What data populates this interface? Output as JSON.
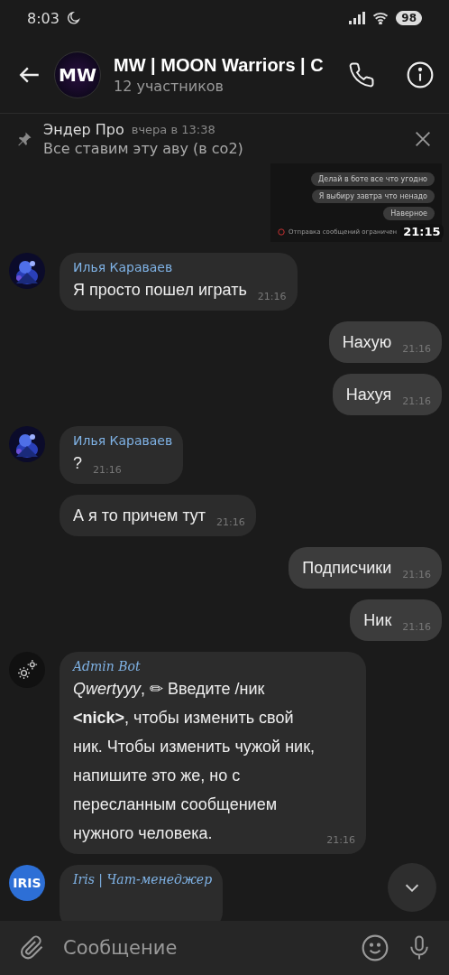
{
  "status_bar": {
    "time": "8:03",
    "battery": "98"
  },
  "header": {
    "avatar_text": "MW",
    "title": "MW | MOON Warriors | С",
    "subtitle": "12 участников"
  },
  "pinned": {
    "author": "Эндер Про",
    "date": "вчера в 13:38",
    "text": "Все ставим эту аву (в со2)"
  },
  "messages": [
    {
      "bubbles": [
        "Делай в боте все что угодно",
        "Я выбиру завтра что ненадо",
        "Наверное"
      ],
      "notice": "Отправка сообщений ограничен",
      "time": "21:15"
    },
    {
      "kind": "in",
      "sender": "Илья Караваев",
      "text": "Я просто пошел играть",
      "time": "21:16"
    },
    {
      "kind": "out",
      "text": "Нахую",
      "time": "21:16"
    },
    {
      "kind": "out",
      "text": "Нахуя",
      "time": "21:16"
    },
    {
      "kind": "in",
      "sender": "Илья Караваев",
      "text": "?",
      "time": "21:16"
    },
    {
      "kind": "in",
      "text": "А я то причем тут",
      "time": "21:16"
    },
    {
      "kind": "out",
      "text": "Подписчики",
      "time": "21:16"
    },
    {
      "kind": "out",
      "text": "Ник",
      "time": "21:16"
    },
    {
      "kind": "in",
      "avatar": {
        "kind": "gear"
      },
      "sender": "Admin Bot",
      "text": "*Qwertyyy*, ✏ Введите /ник **<nick>**, чтобы изменить свой ник. Чтобы изменить чужой ник, напишите это же, но с пересланным сообщением нужного человека.",
      "time": "21:16"
    },
    {
      "kind": "in",
      "avatar": {
        "kind": "text",
        "text": "IRIS"
      },
      "sender": "Iris | Чат-менеджер"
    }
  ],
  "composer": {
    "placeholder": "Сообщение"
  }
}
